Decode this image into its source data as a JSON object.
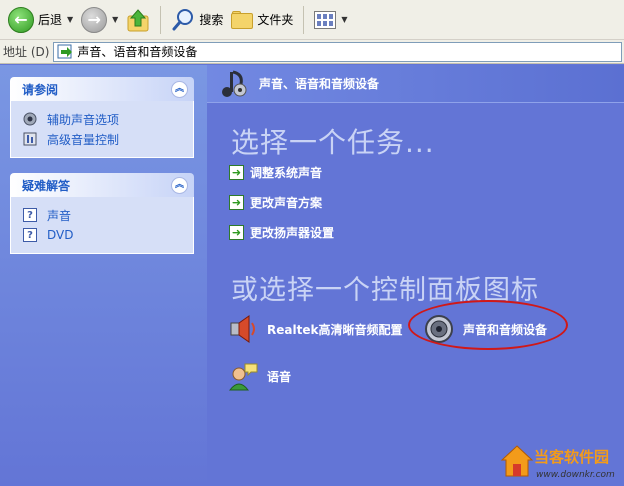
{
  "toolbar": {
    "back_label": "后退",
    "search_label": "搜索",
    "folders_label": "文件夹",
    "icons": [
      "back-arrow-icon",
      "forward-arrow-icon",
      "up-folder-icon",
      "search-icon",
      "folder-icon",
      "views-icon"
    ]
  },
  "address": {
    "label": "地址 (D)",
    "value": "声音、语音和音频设备"
  },
  "sidebar": {
    "see_also": {
      "title": "请参阅",
      "items": [
        {
          "label": "辅助声音选项",
          "icon": "speaker-icon"
        },
        {
          "label": "高级音量控制",
          "icon": "volume-control-icon"
        }
      ]
    },
    "troubleshoot": {
      "title": "疑难解答",
      "items": [
        {
          "label": "声音",
          "icon": "help-icon"
        },
        {
          "label": "DVD",
          "icon": "help-icon"
        }
      ]
    }
  },
  "main": {
    "header_title": "声音、语音和音频设备",
    "task_heading": "选择一个任务...",
    "tasks": [
      {
        "label": "调整系统声音"
      },
      {
        "label": "更改声音方案"
      },
      {
        "label": "更改扬声器设置"
      }
    ],
    "or_heading": "或选择一个控制面板图标",
    "control_panel_items": [
      {
        "label": "Realtek高清晰音频配置",
        "icon": "realtek-speaker-icon"
      },
      {
        "label": "声音和音频设备",
        "icon": "speaker-icon"
      },
      {
        "label": "语音",
        "icon": "speech-icon"
      }
    ]
  },
  "watermark": {
    "name": "当客软件园",
    "url": "www.downkr.com"
  },
  "colors": {
    "pane_blue": "#6375d6",
    "link_blue": "#215dc6",
    "highlight_red": "#d01818"
  }
}
